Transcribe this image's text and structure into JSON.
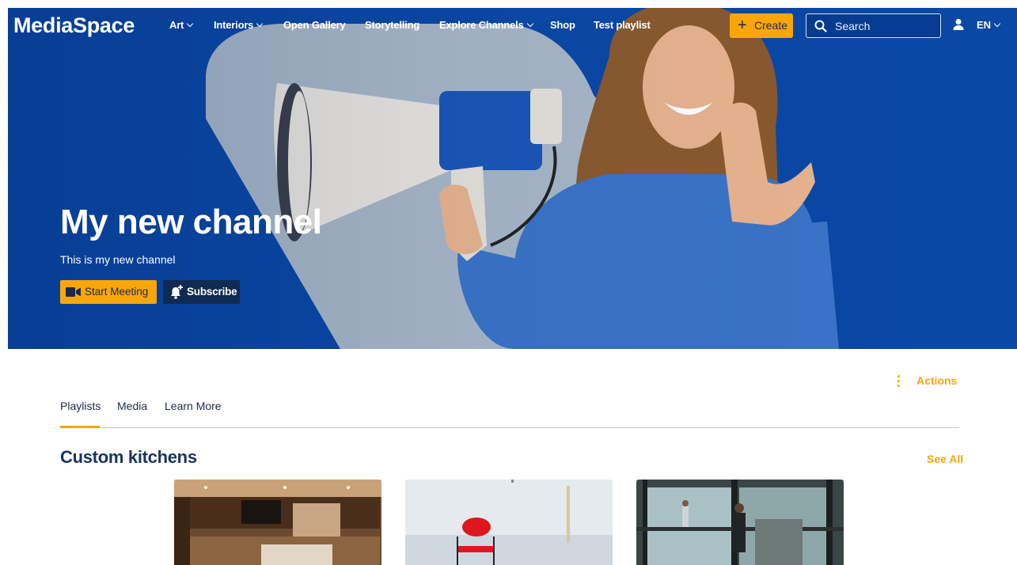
{
  "app": {
    "logo": "MediaSpace"
  },
  "nav": {
    "items": [
      {
        "label": "Art",
        "dropdown": true
      },
      {
        "label": "Interiors",
        "dropdown": true
      },
      {
        "label": "Open Gallery",
        "dropdown": false
      },
      {
        "label": "Storytelling",
        "dropdown": false
      },
      {
        "label": "Explore Channels",
        "dropdown": true
      },
      {
        "label": "Shop",
        "dropdown": false
      },
      {
        "label": "Test playlist",
        "dropdown": false
      }
    ],
    "create_label": "Create",
    "search_placeholder": "Search",
    "language": "EN"
  },
  "hero": {
    "title": "My new channel",
    "description": "This is my new channel",
    "start_meeting_label": "Start Meeting",
    "subscribe_label": "Subscribe"
  },
  "actions_label": "Actions",
  "tabs": [
    {
      "label": "Playlists",
      "active": true
    },
    {
      "label": "Media",
      "active": false
    },
    {
      "label": "Learn More",
      "active": false
    }
  ],
  "section": {
    "title": "Custom kitchens",
    "see_all_label": "See All",
    "thumbnails": [
      {
        "subject": "modern-kitchen"
      },
      {
        "subject": "red-chair"
      },
      {
        "subject": "glass-storefront"
      }
    ]
  },
  "colors": {
    "brand_blue": "#0a48a6",
    "accent_orange": "#f9a60b",
    "dark_navy": "#102a52"
  },
  "icons": [
    "chevron-down-icon",
    "plus-icon",
    "search-icon",
    "user-icon",
    "video-camera-icon",
    "bell-plus-icon",
    "more-vertical-icon"
  ]
}
